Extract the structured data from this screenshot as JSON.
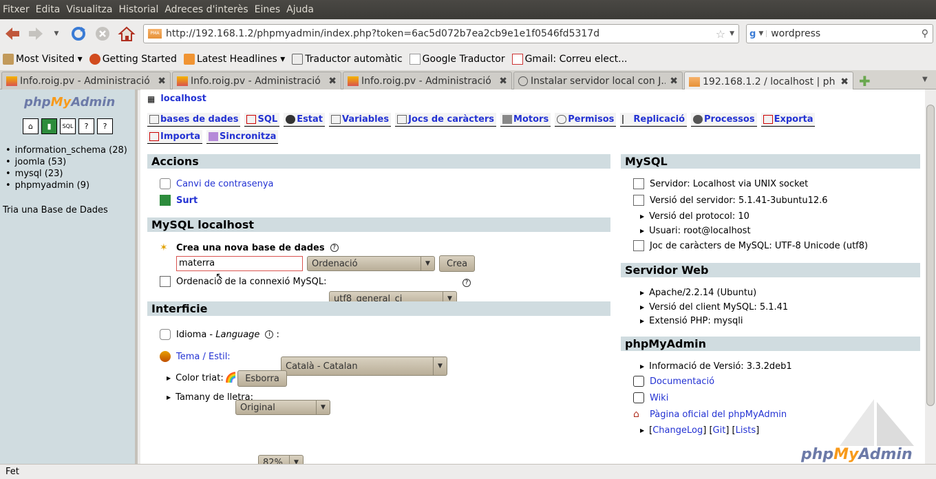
{
  "menu": [
    "Fitxer",
    "Edita",
    "Visualitza",
    "Historial",
    "Adreces d'interès",
    "Eines",
    "Ajuda"
  ],
  "url": "http://192.168.1.2/phpmyadmin/index.php?token=6ac5d072b7ea2cb9e1e1f0546fd5317d",
  "search_value": "wordpress",
  "bookmarks": [
    "Most Visited ▾",
    "Getting Started",
    "Latest Headlines ▾",
    "Traductor automàtic",
    "Google Traductor",
    "Gmail: Correu elect..."
  ],
  "tabs": [
    {
      "label": "Info.roig.pv - Administració"
    },
    {
      "label": "Info.roig.pv - Administració"
    },
    {
      "label": "Info.roig.pv - Administració"
    },
    {
      "label": "Instalar servidor local con J..."
    },
    {
      "label": "192.168.1.2 / localhost | ph..."
    }
  ],
  "left": {
    "logo_php": "php",
    "logo_my": "My",
    "logo_admin": "Admin",
    "databases": [
      "information_schema (28)",
      "joomla (53)",
      "mysql (23)",
      "phpmyadmin (9)"
    ],
    "try_db": "Tria una Base de Dades"
  },
  "main": {
    "server": "localhost",
    "tabs_row1": [
      "bases de dades",
      "SQL",
      "Estat",
      "Variables",
      "Jocs de caràcters",
      "Motors",
      "Permisos",
      "Replicació",
      "Processos",
      "Exporta"
    ],
    "tabs_row2": [
      "Importa",
      "Sincronitza"
    ],
    "accions": {
      "title": "Accions",
      "change_password": "Canvi de contrasenya",
      "logout": "Surt"
    },
    "mysql_local": {
      "title": "MySQL localhost",
      "create_db_label": "Crea una nova base de dades",
      "db_name_value": "materra",
      "collation_placeholder": "Ordenació",
      "create_button": "Crea",
      "conn_collation_label": "Ordenació de la connexió MySQL:",
      "conn_collation_value": "utf8_general_ci"
    },
    "interficie": {
      "title": "Interficie",
      "lang_label": "Idioma - ",
      "lang_label_italic": "Language",
      "lang_value": "Català - Catalan",
      "theme_label": "Tema / Estil:",
      "theme_value": "Original",
      "color_label": "Color triat:",
      "color_button": "Esborra",
      "font_size_label": "Tamany de lletra:",
      "font_size_value": "82%"
    },
    "mysql": {
      "title": "MySQL",
      "server": "Servidor: Localhost via UNIX socket",
      "version": "Versió del servidor: 5.1.41-3ubuntu12.6",
      "protocol": "Versió del protocol: 10",
      "user": "Usuari: root@localhost",
      "charset": "Joc de caràcters de MySQL: UTF-8 Unicode (utf8)"
    },
    "web": {
      "title": "Servidor Web",
      "apache": "Apache/2.2.14 (Ubuntu)",
      "client": "Versió del client MySQL: 5.1.41",
      "ext": "Extensió PHP: mysqli"
    },
    "pma": {
      "title": "phpMyAdmin",
      "version": "Informació de Versió: 3.3.2deb1",
      "docs": "Documentació",
      "wiki": "Wiki",
      "official": "Pàgina oficial del phpMyAdmin",
      "changelog": "ChangeLog",
      "git": "Git",
      "lists": "Lists"
    }
  },
  "status": "Fet",
  "colors": {
    "section_bg": "#d0dce0",
    "link": "#2332d3",
    "accent": "#f89a1b"
  }
}
